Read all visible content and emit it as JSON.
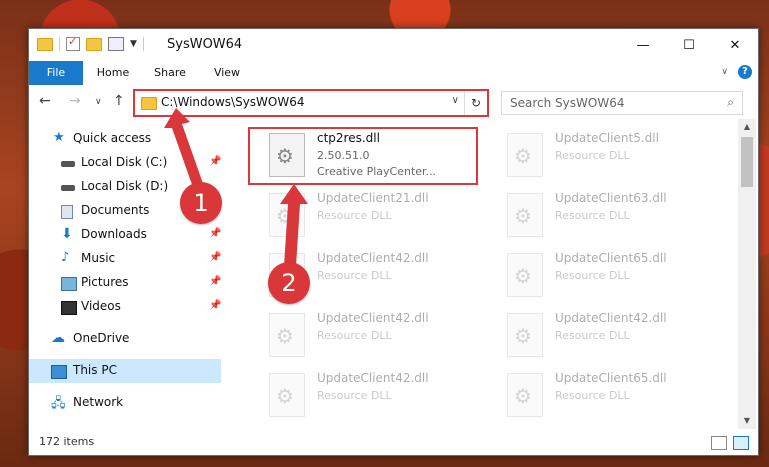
{
  "title": "SysWOW64",
  "window_controls": {
    "minimize": "—",
    "maximize": "☐",
    "close": "✕"
  },
  "ribbon": {
    "tabs": [
      "File",
      "Home",
      "Share",
      "View"
    ],
    "help": "?"
  },
  "address": {
    "path": "C:\\Windows\\SysWOW64",
    "search_placeholder": "Search SysWOW64"
  },
  "nav": {
    "quick_access": "Quick access",
    "items": [
      {
        "label": "Local Disk (C:)",
        "icon": "drive-icon",
        "pinned": true
      },
      {
        "label": "Local Disk (D:)",
        "icon": "drive-icon",
        "pinned": false
      },
      {
        "label": "Documents",
        "icon": "documents-icon",
        "pinned": true
      },
      {
        "label": "Downloads",
        "icon": "downloads-icon",
        "pinned": true
      },
      {
        "label": "Music",
        "icon": "music-icon",
        "pinned": true
      },
      {
        "label": "Pictures",
        "icon": "pictures-icon",
        "pinned": true
      },
      {
        "label": "Videos",
        "icon": "videos-icon",
        "pinned": true
      }
    ],
    "onedrive": "OneDrive",
    "this_pc": "This PC",
    "network": "Network"
  },
  "files": [
    {
      "name": "ctp2res.dll",
      "meta1": "2.50.51.0",
      "meta2": "Creative PlayCenter...",
      "highlighted": true
    },
    {
      "name": "UpdateClient5.dll",
      "meta1": "Resource DLL"
    },
    {
      "name": "UpdateClient21.dll",
      "meta1": "Resource DLL"
    },
    {
      "name": "UpdateClient63.dll",
      "meta1": "Resource DLL"
    },
    {
      "name": "UpdateClient42.dll",
      "meta1": "Resource DLL"
    },
    {
      "name": "UpdateClient65.dll",
      "meta1": "Resource DLL"
    },
    {
      "name": "UpdateClient42.dll",
      "meta1": "Resource DLL"
    },
    {
      "name": "UpdateClient42.dll",
      "meta1": "Resource DLL"
    },
    {
      "name": "UpdateClient42.dll",
      "meta1": "Resource DLL"
    },
    {
      "name": "UpdateClient65.dll",
      "meta1": "Resource DLL"
    }
  ],
  "status": {
    "item_count": "172 items"
  },
  "callouts": [
    "1",
    "2"
  ],
  "colors": {
    "accent": "#1979ca",
    "highlight": "#d9373a",
    "selected": "#cce8ff"
  }
}
